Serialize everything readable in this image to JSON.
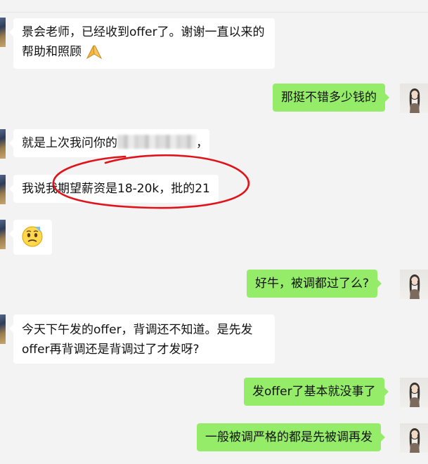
{
  "messages": [
    {
      "side": "left",
      "text": "景会老师，已经收到offer了。谢谢一直以来的帮助和照顾",
      "emoji": "folded-hands-emoji"
    },
    {
      "side": "right",
      "text": "那挺不错多少钱的"
    },
    {
      "side": "left",
      "text_before": "就是上次我问你的",
      "text_after": "，",
      "redacted": true
    },
    {
      "side": "left",
      "text": "我说我期望薪资是18-20k，批的21"
    },
    {
      "side": "left",
      "emoji": "nervous-face-emoji"
    },
    {
      "side": "right",
      "text": "好牛，被调都过了么?"
    },
    {
      "side": "left",
      "text_line1": "今天下午发的offer，背调还不知道。是先发",
      "text_line2": "offer再背调还是背调过了才发呀?"
    },
    {
      "side": "right",
      "text": "发offer了基本就没事了"
    },
    {
      "side": "right",
      "text": "一般被调严格的都是先被调再发"
    }
  ],
  "colors": {
    "background": "#f3f3f3",
    "sent_bubble": "#95ec69",
    "received_bubble": "#ffffff",
    "annotation_circle": "#e0131b"
  }
}
